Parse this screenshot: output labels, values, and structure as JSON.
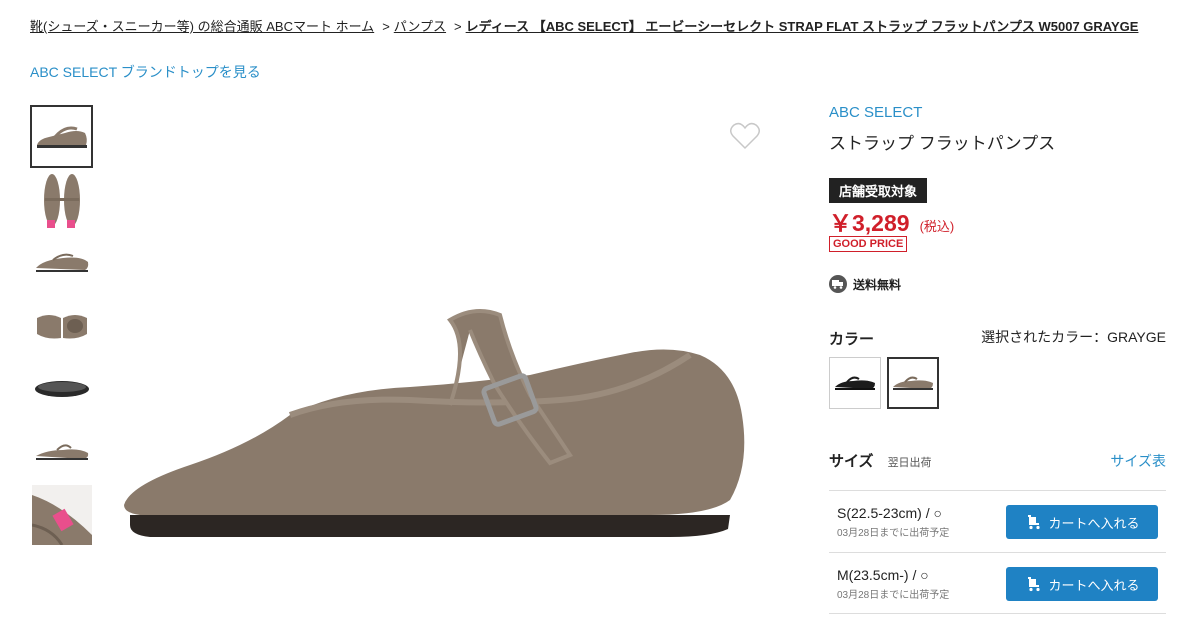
{
  "breadcrumb": {
    "home": "靴(シューズ・スニーカー等) の総合通販 ABCマート ホーム",
    "category": "パンプス",
    "current": "レディース 【ABC SELECT】 エービーシーセレクト STRAP FLAT ストラップ フラットパンプス W5007 GRAYGE"
  },
  "brand_top_link": "ABC SELECT ブランドトップを見る",
  "product": {
    "brand": "ABC SELECT",
    "name": "ストラップ フラットパンプス",
    "store_badge": "店舗受取対象",
    "price": "￥3,289",
    "tax_note": "(税込)",
    "good_price": "GOOD PRICE",
    "shipping": "送料無料"
  },
  "color": {
    "label": "カラー",
    "selected_text": "選択されたカラー：GRAYGE"
  },
  "size": {
    "label": "サイズ",
    "next_day": "翌日出荷",
    "chart_link": "サイズ表",
    "rows": [
      {
        "name": "S(22.5-23cm) / ○",
        "ship": "03月28日までに出荷予定",
        "button": "カートへ入れる"
      },
      {
        "name": "M(23.5cm-) / ○",
        "ship": "03月28日までに出荷予定",
        "button": "カートへ入れる"
      }
    ]
  },
  "colors": {
    "accent": "#2a8fc8",
    "price": "#d01f2a",
    "cart": "#1f82c4",
    "shoe": "#8a7a6b"
  }
}
